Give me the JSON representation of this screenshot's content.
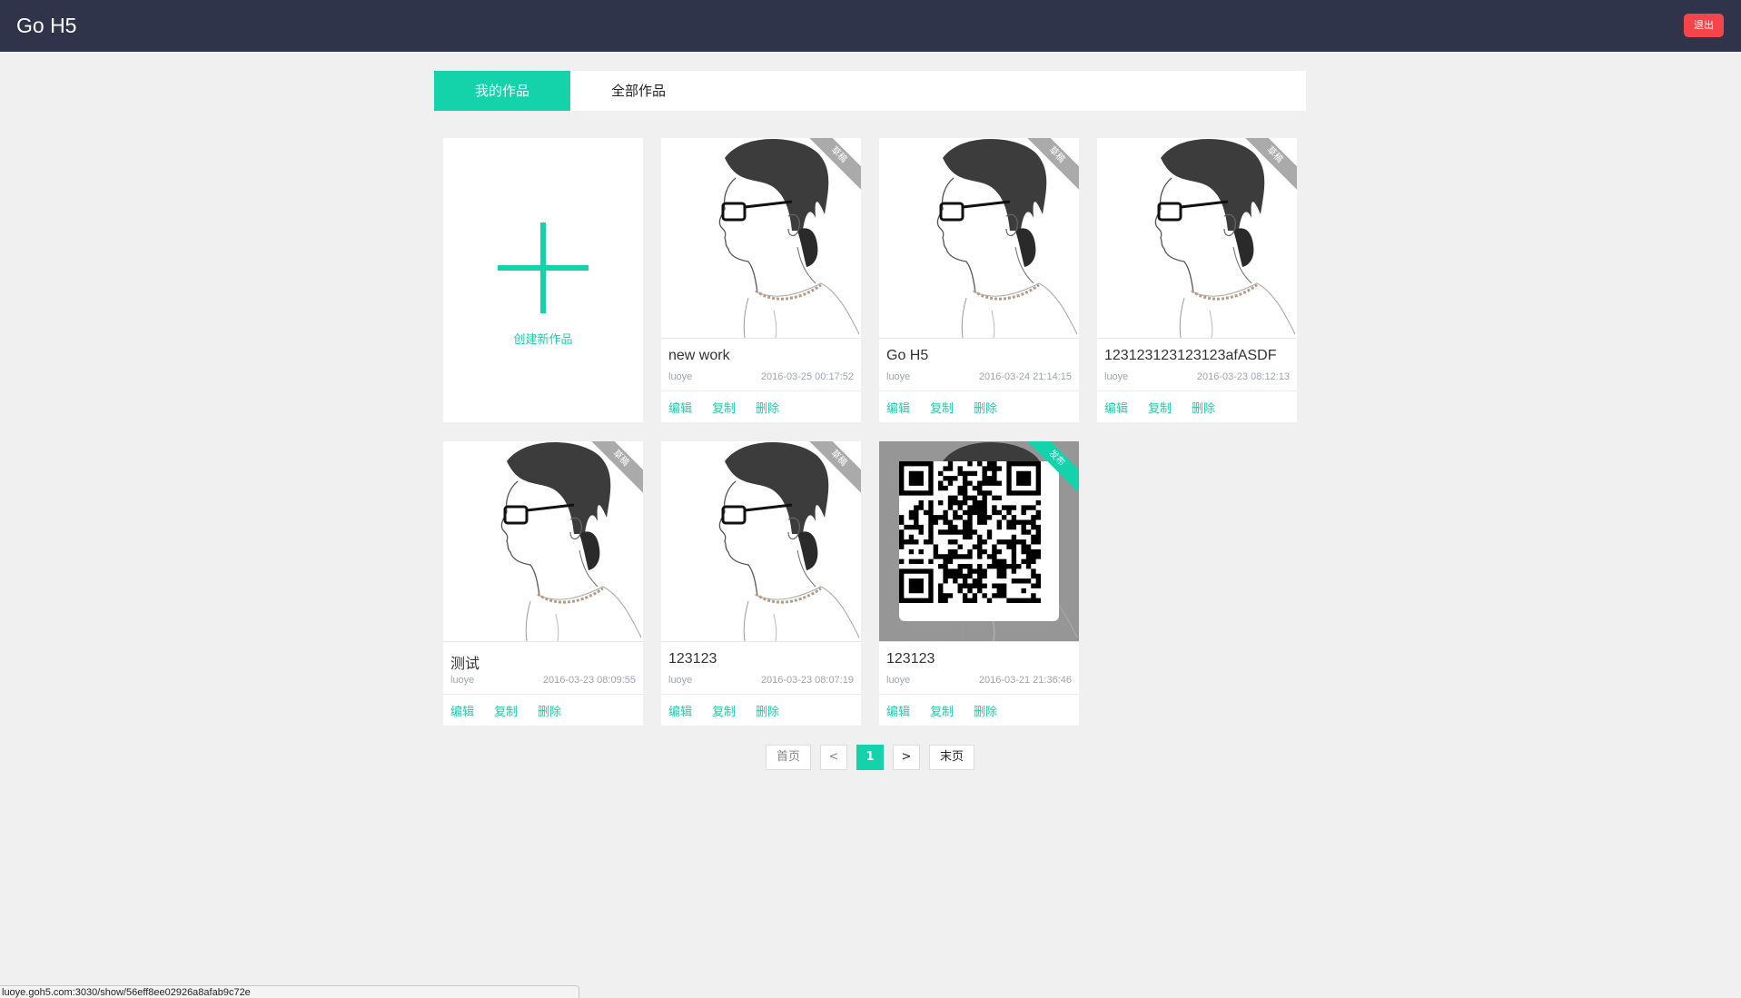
{
  "header": {
    "brand": "Go H5",
    "logout_label": "退出"
  },
  "tabs": [
    {
      "label": "我的作品",
      "active": true
    },
    {
      "label": "全部作品",
      "active": false
    }
  ],
  "create_card": {
    "label": "创建新作品",
    "icon": "plus-icon"
  },
  "works": [
    {
      "title": "new work",
      "author": "luoye",
      "date": "2016-03-25 00:17:52",
      "status": "草稿",
      "thumb": "portrait"
    },
    {
      "title": "Go H5",
      "author": "luoye",
      "date": "2016-03-24 21:14:15",
      "status": "草稿",
      "thumb": "portrait"
    },
    {
      "title": "123123123123123afASDF",
      "author": "luoye",
      "date": "2016-03-23 08:12:13",
      "status": "草稿",
      "thumb": "portrait"
    },
    {
      "title": "测试",
      "author": "luoye",
      "date": "2016-03-23 08:09:55",
      "status": "草稿",
      "thumb": "portrait"
    },
    {
      "title": "123123",
      "author": "luoye",
      "date": "2016-03-23 08:07:19",
      "status": "草稿",
      "thumb": "portrait"
    },
    {
      "title": "123123",
      "author": "luoye",
      "date": "2016-03-21 21:36:46",
      "status": "发布",
      "thumb": "qr-code"
    }
  ],
  "actions": {
    "edit": "编辑",
    "copy": "复制",
    "delete": "删除"
  },
  "pagination": {
    "first": "首页",
    "prev": "<",
    "current": "1",
    "next": ">",
    "last": "末页"
  },
  "status_bar": {
    "url": "luoye.goh5.com:3030/show/56eff8ee02926a8afab9c72e"
  },
  "colors": {
    "accent": "#14d3aa",
    "header_bg": "#30344a",
    "logout_bg": "#f5454b",
    "page_bg": "#f0f0f0"
  }
}
